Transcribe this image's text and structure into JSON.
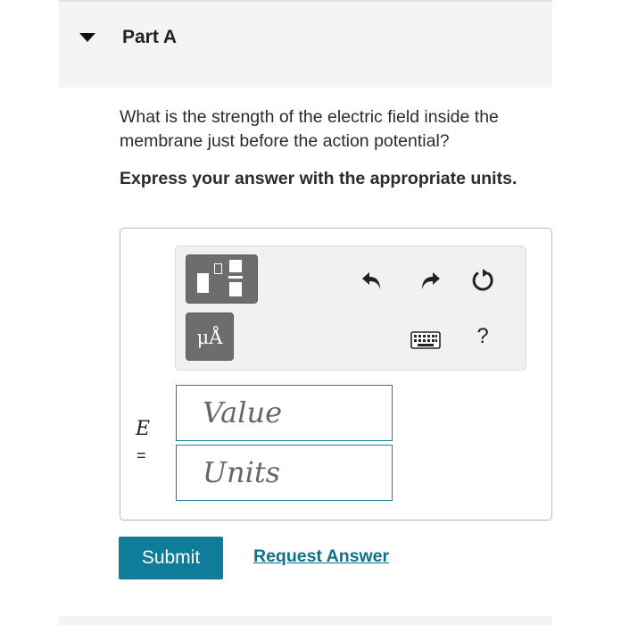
{
  "part": {
    "title": "Part A"
  },
  "question": {
    "text": "What is the strength of the electric field inside the membrane just before the action potential?"
  },
  "instruction": {
    "text": "Express your answer with the appropriate units."
  },
  "toolbar": {
    "templates_icon": "templates-icon",
    "units_label": "μÅ",
    "undo_icon": "undo-icon",
    "redo_icon": "redo-icon",
    "reset_icon": "reset-icon",
    "keyboard_icon": "keyboard-icon",
    "help_label": "?"
  },
  "answer": {
    "variable": "E",
    "equals": "=",
    "value_placeholder": "Value",
    "units_placeholder": "Units"
  },
  "actions": {
    "submit_label": "Submit",
    "request_label": "Request Answer"
  },
  "colors": {
    "accent": "#0f7c9a",
    "link": "#0f6f8d",
    "toolbar_button": "#6d6d6d"
  }
}
